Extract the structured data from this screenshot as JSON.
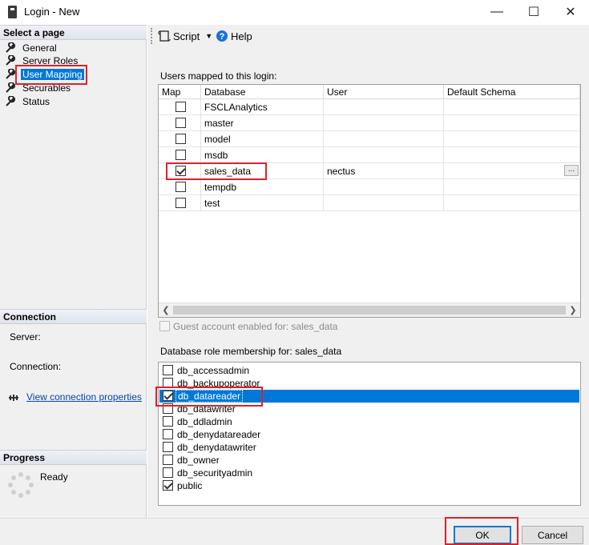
{
  "window": {
    "title": "Login - New",
    "minimize_glyph": "—",
    "maximize_glyph": "☐",
    "close_glyph": "✕"
  },
  "left_pane": {
    "select_page_header": "Select a page",
    "pages": [
      {
        "label": "General",
        "icon": "wrench-icon",
        "selected": false
      },
      {
        "label": "Server Roles",
        "icon": "wrench-icon",
        "selected": false
      },
      {
        "label": "User Mapping",
        "icon": "wrench-icon",
        "selected": true
      },
      {
        "label": "Securables",
        "icon": "wrench-icon",
        "selected": false
      },
      {
        "label": "Status",
        "icon": "wrench-icon",
        "selected": false
      }
    ],
    "connection_header": "Connection",
    "server_label": "Server:",
    "connection_label": "Connection:",
    "view_connection_properties": "View connection properties",
    "progress_header": "Progress",
    "progress_status": "Ready"
  },
  "toolbar": {
    "script_label": "Script",
    "help_label": "Help"
  },
  "users_section": {
    "caption": "Users mapped to this login:",
    "columns": [
      "Map",
      "Database",
      "User",
      "Default Schema"
    ],
    "rows": [
      {
        "map": false,
        "database": "FSCLAnalytics",
        "user": "",
        "schema": ""
      },
      {
        "map": false,
        "database": "master",
        "user": "",
        "schema": ""
      },
      {
        "map": false,
        "database": "model",
        "user": "",
        "schema": ""
      },
      {
        "map": false,
        "database": "msdb",
        "user": "",
        "schema": ""
      },
      {
        "map": true,
        "database": "sales_data",
        "user": "nectus",
        "schema": ""
      },
      {
        "map": false,
        "database": "tempdb",
        "user": "",
        "schema": ""
      },
      {
        "map": false,
        "database": "test",
        "user": "",
        "schema": ""
      }
    ],
    "ellipsis_label": "...",
    "guest_account_label": "Guest account enabled for: sales_data"
  },
  "roles_section": {
    "caption": "Database role membership for: sales_data",
    "roles": [
      {
        "name": "db_accessadmin",
        "checked": false
      },
      {
        "name": "db_backupoperator",
        "checked": false
      },
      {
        "name": "db_datareader",
        "checked": true,
        "selected": true
      },
      {
        "name": "db_datawriter",
        "checked": false
      },
      {
        "name": "db_ddladmin",
        "checked": false
      },
      {
        "name": "db_denydatareader",
        "checked": false
      },
      {
        "name": "db_denydatawriter",
        "checked": false
      },
      {
        "name": "db_owner",
        "checked": false
      },
      {
        "name": "db_securityadmin",
        "checked": false
      },
      {
        "name": "public",
        "checked": true
      }
    ]
  },
  "buttons": {
    "ok": "OK",
    "cancel": "Cancel"
  },
  "colors": {
    "selection": "#0078d7",
    "highlight_box": "#e0202a",
    "link": "#0645ad"
  }
}
